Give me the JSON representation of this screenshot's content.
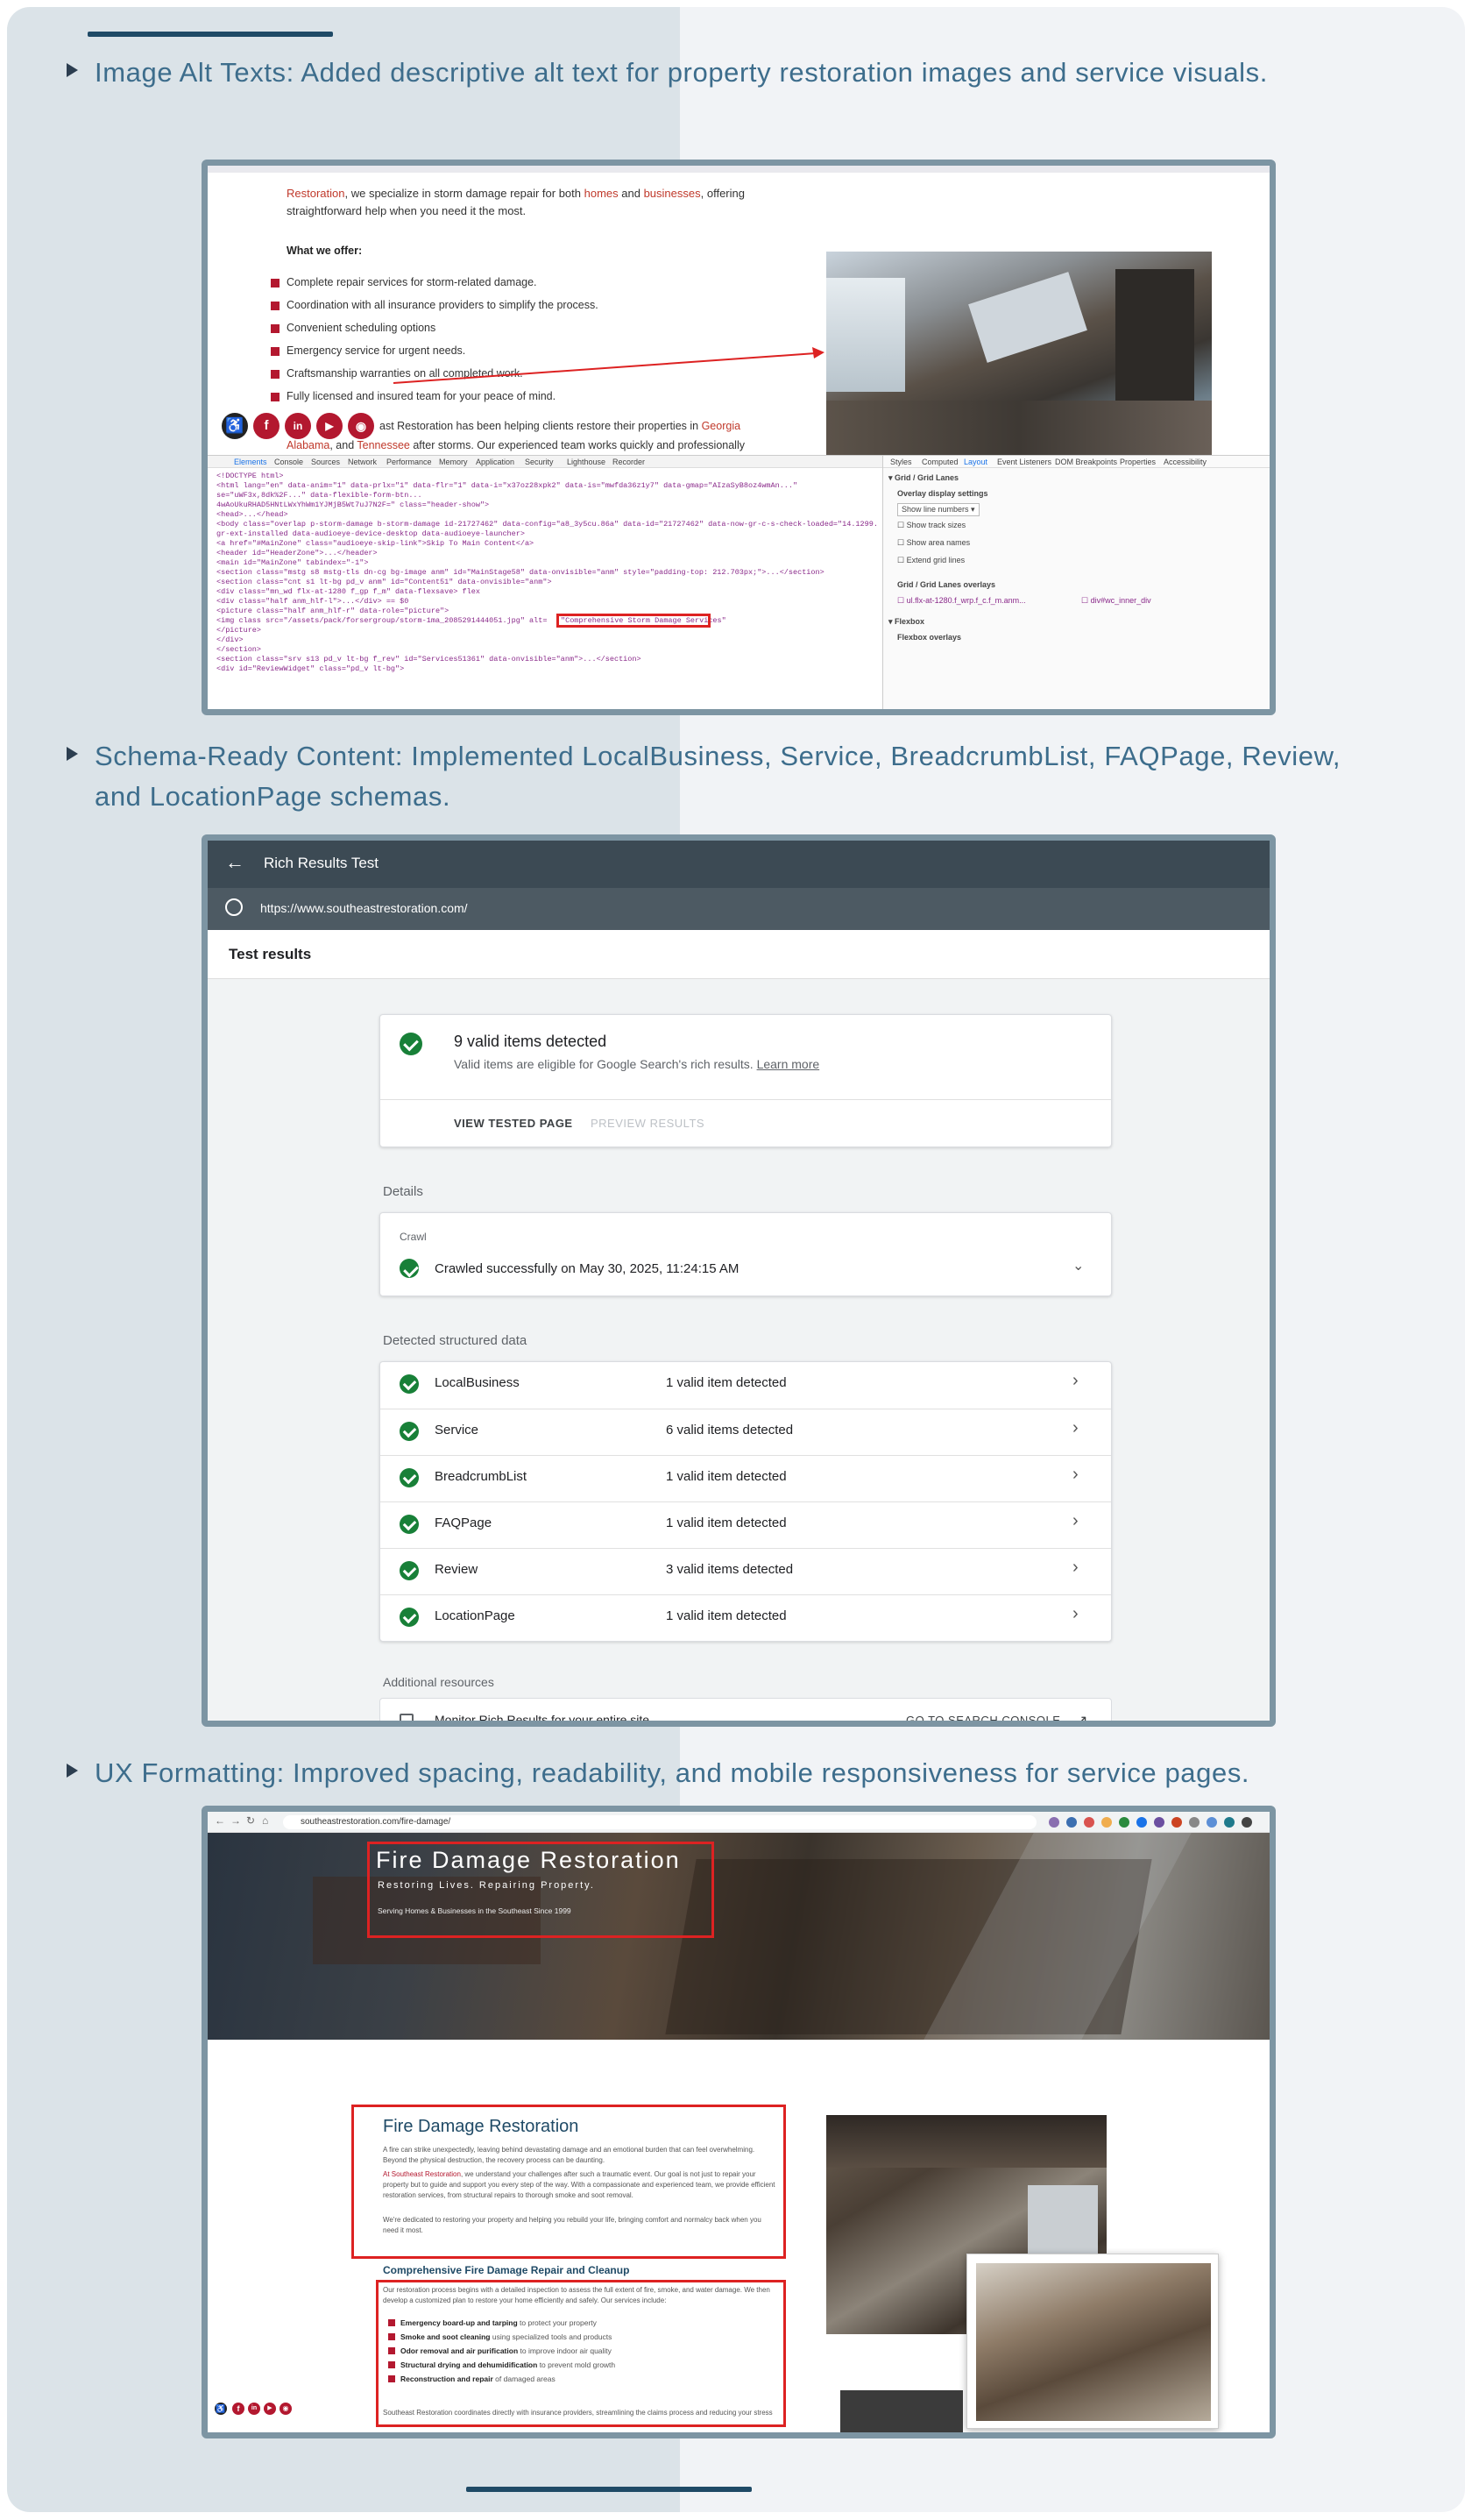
{
  "sections": [
    {
      "text": "Image Alt Texts: Added descriptive alt text for property restoration images and service visuals."
    },
    {
      "text": "Schema-Ready Content: Implemented LocalBusiness, Service, BreadcrumbList, FAQPage, Review, and LocationPage schemas."
    },
    {
      "text": "UX Formatting: Improved spacing, readability, and mobile responsiveness for service pages."
    }
  ],
  "shot1": {
    "intro_link": "Restoration",
    "intro_mid": ", we specialize in storm damage repair for both ",
    "intro_homes": "homes",
    "intro_and": " and ",
    "intro_biz": "businesses",
    "intro_end": ", offering",
    "intro_line2": "straightforward help when you need it the most.",
    "offer_heading": "What we offer:",
    "offers": [
      "Complete repair services for storm-related damage.",
      "Coordination with all insurance providers to simplify the process.",
      "Convenient scheduling options",
      "Emergency service for urgent needs.",
      "Craftsmanship warranties on all completed work.",
      "Fully licensed and insured team for your peace of mind."
    ],
    "para_start": "ast Restoration has been helping clients restore their properties in ",
    "para_ga": "Georgia",
    "para_line2_al": "Alabama",
    "para_line2_mid": ", and ",
    "para_line2_tn": "Tennessee",
    "para_line2_end": " after storms. Our experienced team works quickly and professionally",
    "devtools_tabs": [
      "Elements",
      "Console",
      "Sources",
      "Network",
      "Performance",
      "Memory",
      "Application",
      "Security",
      "Lighthouse",
      "Recorder"
    ],
    "style_tabs": [
      "Styles",
      "Computed",
      "Layout",
      "Event Listeners",
      "DOM Breakpoints",
      "Properties",
      "Accessibility"
    ],
    "grid_heading": "Grid / Grid Lanes",
    "overlay_heading": "Overlay display settings",
    "overlay_select": "Show line numbers",
    "overlay_opts": [
      "Show track sizes",
      "Show area names",
      "Extend grid lines"
    ],
    "overlays_heading": "Grid / Grid Lanes overlays",
    "overlay_items": [
      "ul.flx-at-1280.f_wrp.f_c.f_m.anm...",
      "div#wc_inner_div"
    ],
    "flexbox_heading": "Flexbox",
    "flexbox_overlays": "Flexbox overlays",
    "code_lines": [
      "<!DOCTYPE html>",
      "<html lang=\"en\" data-anim=\"1\" data-prlx=\"1\" data-flr=\"1\" data-i=\"x37oz28xpk2\" data-is=\"mwfda36z1y7\" data-gmap=\"AIzaSyB8oz4wmAn...\"",
      "  se=\"uWF3x,8dk%2F...\" data-flexible-form-btn...",
      "4wAoUkuRHAD5HNtLWxYhWm1YJMjB5Wt7uJ7N2F=\" class=\"header-show\">",
      " <head>...</head>",
      " <body class=\"overlap p-storm-damage b-storm-damage id-21727462\" data-config=\"a8_3y5cu.86a\" data-id=\"21727462\" data-now-gr-c-s-check-loaded=\"14.1299.0\" data-",
      "   gr-ext-installed data-audioeye-device-desktop data-audioeye-launcher>",
      "   <a href=\"#MainZone\" class=\"audioeye-skip-link\">Skip To Main Content</a>",
      "   <header id=\"HeaderZone\">...</header>",
      "   <main id=\"MainZone\" tabindex=\"-1\">",
      "     <section class=\"mstg s8 mstg-tls dn-cg bg-image anm\" id=\"MainStage58\" data-onvisible=\"anm\" style=\"padding-top: 212.703px;\">...</section>",
      "     <section class=\"cnt s1 lt-bg pd_v anm\" id=\"Content51\" data-onvisible=\"anm\">",
      "       <div class=\"mn_wd flx-at-1280 f_gp f_m\" data-flexsave> flex",
      "         <div class=\"half anm_hlf-l\">...</div> == $0",
      "         <picture class=\"half anm_hlf-r\" data-role=\"picture\">",
      "           <img class src=\"/assets/pack/forsergroup/storm-1ma_2085291444051.jpg\" alt=",
      "         </picture>",
      "       </div>",
      "     </section>",
      "     <section class=\"srv s13 pd_v lt-bg f_rev\" id=\"Services51361\" data-onvisible=\"anm\">...</section>",
      "     <div id=\"ReviewWidget\" class=\"pd_v lt-bg\">"
    ],
    "alt_value": "\"Comprehensive Storm Damage Services\""
  },
  "shot2": {
    "title": "Rich Results Test",
    "url": "https://www.southeastrestoration.com/",
    "test_results": "Test results",
    "valid_count": "9 valid items detected",
    "valid_sub_a": "Valid items are eligible for Google Search's rich results. ",
    "learn_more": "Learn more",
    "view_tested": "VIEW TESTED PAGE",
    "preview": "PREVIEW RESULTS",
    "details": "Details",
    "crawl": "Crawl",
    "crawled": "Crawled successfully on May 30, 2025, 11:24:15 AM",
    "detected": "Detected structured data",
    "items": [
      {
        "name": "LocalBusiness",
        "count": "1 valid item detected"
      },
      {
        "name": "Service",
        "count": "6 valid items detected"
      },
      {
        "name": "BreadcrumbList",
        "count": "1 valid item detected"
      },
      {
        "name": "FAQPage",
        "count": "1 valid item detected"
      },
      {
        "name": "Review",
        "count": "3 valid items detected"
      },
      {
        "name": "LocationPage",
        "count": "1 valid item detected"
      }
    ],
    "additional": "Additional resources",
    "monitor": "Monitor Rich Results for your entire site",
    "console": "GO TO SEARCH CONSOLE"
  },
  "shot3": {
    "url": "southeastrestoration.com/fire-damage/",
    "hero_title": "Fire Damage Restoration",
    "hero_tag": "Restoring Lives. Repairing Property.",
    "hero_sub": "Serving Homes & Businesses in the Southeast Since 1999",
    "h1": "Fire Damage Restoration",
    "p1": "A fire can strike unexpectedly, leaving behind devastating damage and an emotional burden that can feel overwhelming. Beyond the physical destruction, the recovery process can be daunting.",
    "p2_brand": "At Southeast Restoration",
    "p2": ", we understand your challenges after such a traumatic event. Our goal is not just to repair your property but to guide and support you every step of the way. With a compassionate and experienced team, we provide efficient restoration services, from structural repairs to thorough smoke and soot removal.",
    "p3": "We're dedicated to restoring your property and helping you rebuild your life, bringing comfort and normalcy back when you need it most.",
    "h2": "Comprehensive Fire Damage Repair and Cleanup",
    "p4": "Our restoration process begins with a detailed inspection to assess the full extent of fire, smoke, and water damage. We then develop a customized plan to restore your home efficiently and safely. Our services include:",
    "list": [
      {
        "b": "Emergency board-up and tarping",
        "t": " to protect your property"
      },
      {
        "b": "Smoke and soot cleaning",
        "t": " using specialized tools and products"
      },
      {
        "b": "Odor removal and air purification",
        "t": " to improve indoor air quality"
      },
      {
        "b": "Structural drying and dehumidification",
        "t": " to prevent mold growth"
      },
      {
        "b": "Reconstruction and repair",
        "t": " of damaged areas"
      }
    ],
    "p5": "Southeast Restoration coordinates directly with insurance providers, streamlining the claims process and reducing your stress"
  },
  "colors": {
    "accent": "#3d6d8c",
    "frame": "#7d95a3",
    "brand_red": "#b3182f",
    "google_green": "#188038"
  }
}
